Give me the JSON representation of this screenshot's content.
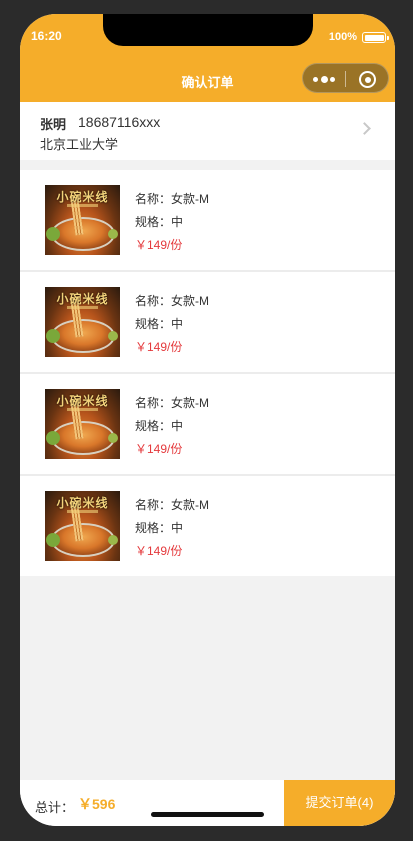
{
  "status": {
    "time": "16:20",
    "battery": "100%"
  },
  "nav": {
    "title": "确认订单"
  },
  "address": {
    "name": "张明",
    "phone": "18687116xxx",
    "school": "北京工业大学"
  },
  "items": [
    {
      "logo": "小碗米线",
      "name": "名称：女款-M",
      "spec": "规格：中",
      "price": "￥149/份"
    },
    {
      "logo": "小碗米线",
      "name": "名称：女款-M",
      "spec": "规格：中",
      "price": "￥149/份"
    },
    {
      "logo": "小碗米线",
      "name": "名称：女款-M",
      "spec": "规格：中",
      "price": "￥149/份"
    },
    {
      "logo": "小碗米线",
      "name": "名称：女款-M",
      "spec": "规格：中",
      "price": "￥149/份"
    }
  ],
  "footer": {
    "total_label": "总计：",
    "total_value": "￥596",
    "submit_label": "提交订单(4)"
  },
  "colors": {
    "accent": "#f5ad2a",
    "price": "#e4393c"
  }
}
